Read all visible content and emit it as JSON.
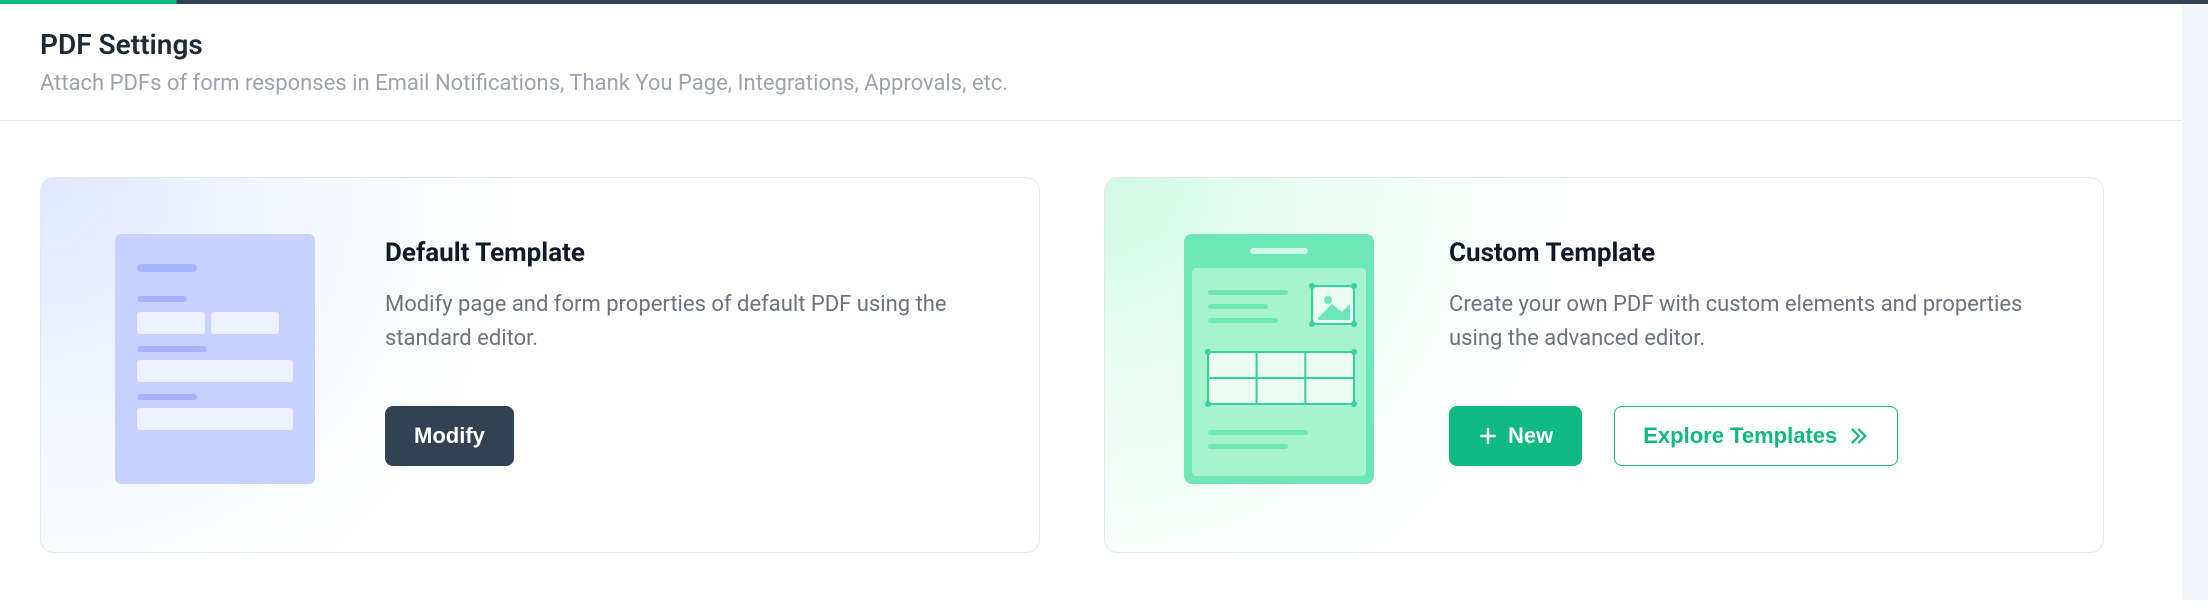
{
  "header": {
    "title": "PDF Settings",
    "subtitle": "Attach PDFs of form responses in Email Notifications, Thank You Page, Integrations, Approvals, etc."
  },
  "cards": {
    "default": {
      "title": "Default Template",
      "desc": "Modify page and form properties of default PDF using the standard editor.",
      "modify_label": "Modify"
    },
    "custom": {
      "title": "Custom Template",
      "desc": "Create your own PDF with custom elements and properties using the advanced editor.",
      "new_label": "New",
      "explore_label": "Explore Templates"
    }
  }
}
